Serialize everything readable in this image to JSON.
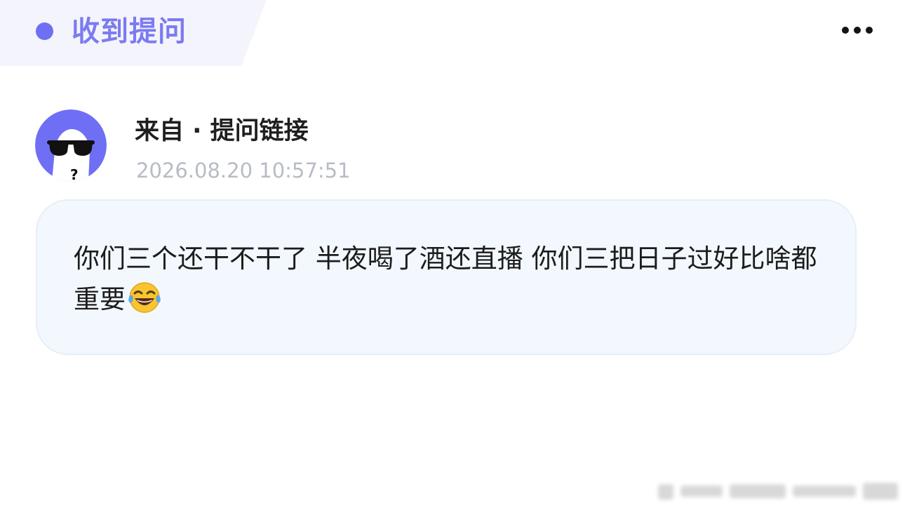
{
  "header": {
    "title": "收到提问",
    "accent_color": "#7b7bf2",
    "dot_color": "#6f6ff5",
    "more_icon": "more-horizontal-icon"
  },
  "sender": {
    "name": "来自 · 提问链接",
    "timestamp": "2026.08.20 10:57:51",
    "avatar": "anonymous-sunglasses-avatar"
  },
  "question": {
    "text": "你们三个还干不干了 半夜喝了酒还直播 你们三把日子过好比啥都重要",
    "emoji": "😂",
    "background_color": "#f2f8fd"
  },
  "watermark": {
    "icon": "blurred-watermark"
  }
}
